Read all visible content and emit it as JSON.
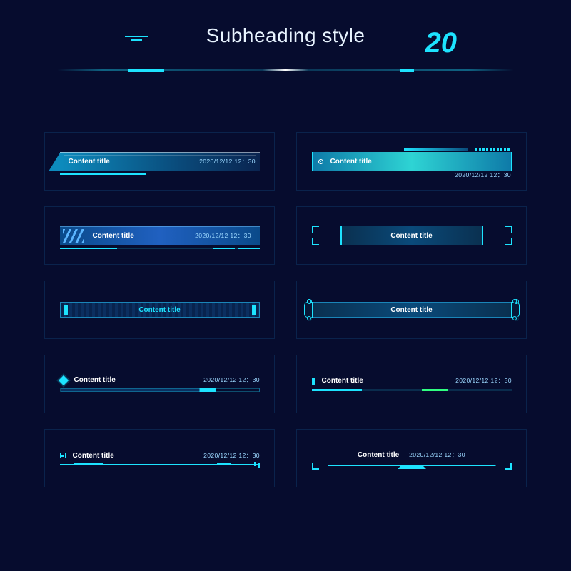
{
  "header": {
    "title": "Subheading style",
    "count": "20"
  },
  "items": [
    {
      "title": "Content title",
      "timestamp": "2020/12/12 12：30"
    },
    {
      "title": "Content title",
      "timestamp": "2020/12/12 12：30"
    },
    {
      "title": "Content title",
      "timestamp": "2020/12/12 12：30"
    },
    {
      "title": "Content title"
    },
    {
      "title": "Content title"
    },
    {
      "title": "Content title"
    },
    {
      "title": "Content title",
      "timestamp": "2020/12/12 12：30"
    },
    {
      "title": "Content title",
      "timestamp": "2020/12/12 12：30"
    },
    {
      "title": "Content title",
      "timestamp": "2020/12/12 12：30"
    },
    {
      "title": "Content title",
      "timestamp": "2020/12/12 12：30"
    }
  ],
  "colors": {
    "accent": "#1de3ff",
    "bg": "#060c2e"
  }
}
